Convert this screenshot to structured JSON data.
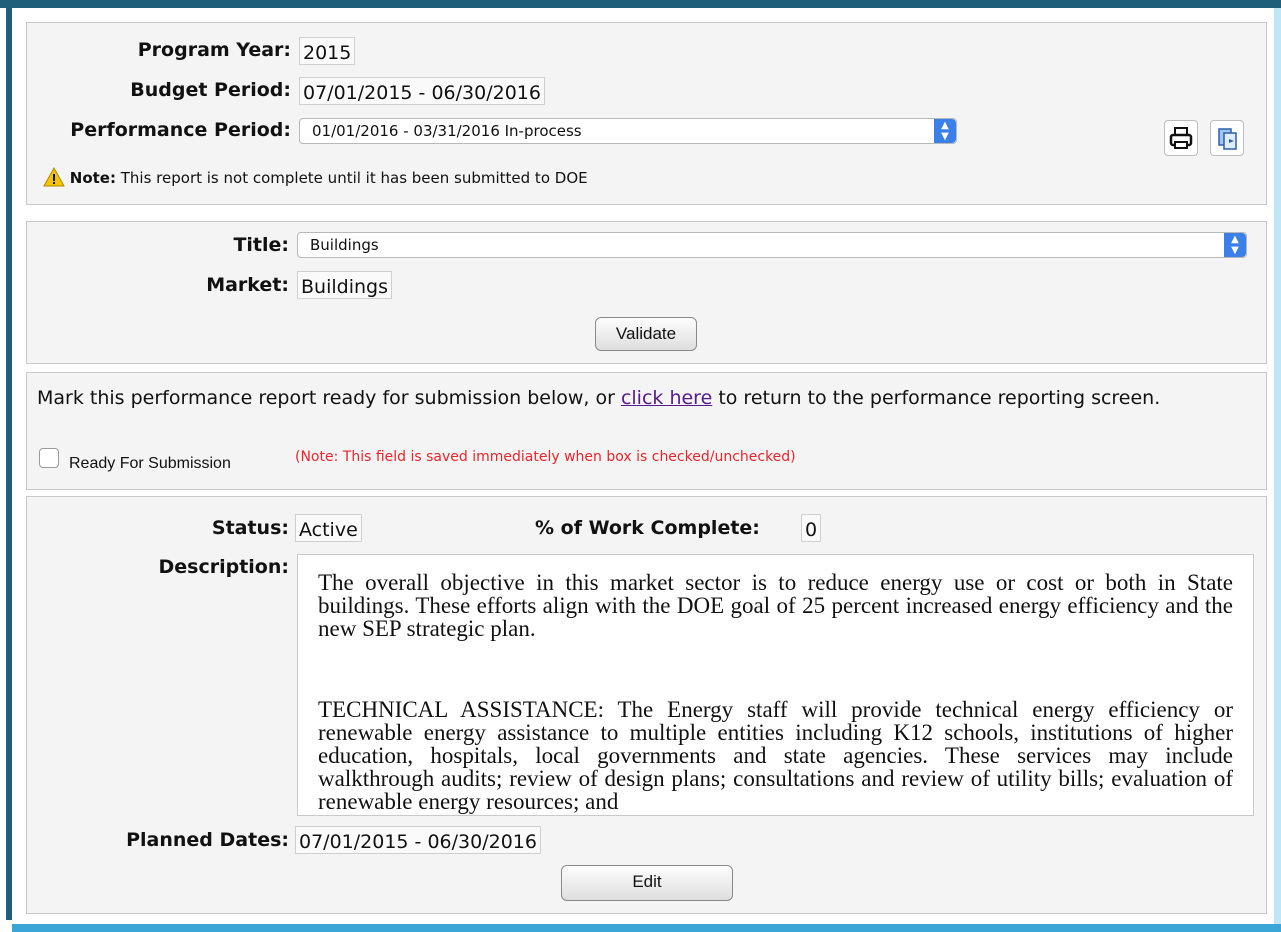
{
  "header": {
    "program_year_label": "Program Year:",
    "program_year_value": "2015",
    "budget_period_label": "Budget Period:",
    "budget_period_value": "07/01/2015 - 06/30/2016",
    "performance_period_label": "Performance Period:",
    "performance_period_value": "01/01/2016 - 03/31/2016 In-process",
    "note_label": "Note:",
    "note_text": "This report is not complete until it has been submitted to DOE",
    "print_icon": "printer-icon",
    "export_icon": "export-document-icon"
  },
  "title_section": {
    "title_label": "Title:",
    "title_value": "Buildings",
    "market_label": "Market:",
    "market_value": "Buildings",
    "validate_label": "Validate"
  },
  "submission": {
    "text_before": "Mark this performance report ready for submission below, or",
    "link_text": "click here",
    "text_after": "to return to the performance reporting screen.",
    "checkbox_label": "Ready For Submission",
    "checkbox_checked": false,
    "checkbox_note": "(Note: This field is saved immediately when box is checked/unchecked)"
  },
  "details": {
    "status_label": "Status:",
    "status_value": "Active",
    "work_complete_label": "% of Work Complete:",
    "work_complete_value": "0",
    "description_label": "Description:",
    "description_paragraphs": [
      "The overall objective in this market sector is to reduce energy use or cost or both in State buildings. These efforts align with the DOE goal of 25 percent increased energy efficiency and the new SEP strategic plan.",
      "TECHNICAL ASSISTANCE: The Energy staff will provide technical energy efficiency or renewable energy assistance to multiple entities including K12 schools, institutions of higher education, hospitals, local governments and state agencies. These services may include walkthrough audits; review of design plans; consultations and review of utility bills; evaluation of renewable energy resources; and"
    ],
    "planned_dates_label": "Planned Dates:",
    "planned_dates_value": "07/01/2015 - 06/30/2016",
    "edit_label": "Edit"
  },
  "colors": {
    "frame_dark": "#1f5f7a",
    "frame_accent": "#3aa6d8",
    "select_arrow": "#3b7fe8",
    "link": "#551a8b",
    "note_red": "#e8262b"
  }
}
